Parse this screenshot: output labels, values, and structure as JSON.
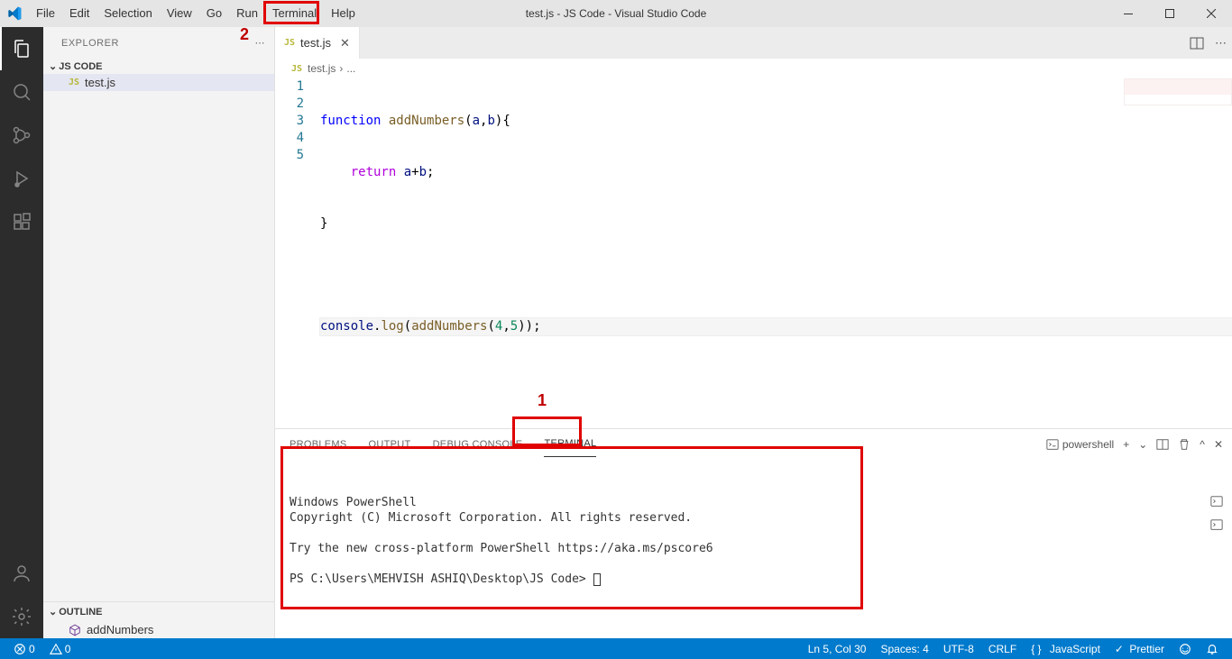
{
  "title": "test.js - JS Code - Visual Studio Code",
  "menu": [
    "File",
    "Edit",
    "Selection",
    "View",
    "Go",
    "Run",
    "Terminal",
    "Help"
  ],
  "sidebar": {
    "title": "EXPLORER",
    "folder": "JS CODE",
    "file": "test.js",
    "outline_title": "OUTLINE",
    "outline_item": "addNumbers"
  },
  "tab": {
    "label": "test.js"
  },
  "breadcrumb": {
    "file": "test.js",
    "sep": "›",
    "rest": "..."
  },
  "code": {
    "lines": [
      "1",
      "2",
      "3",
      "4",
      "5"
    ],
    "l1_kw": "function",
    "l1_fn": " addNumbers",
    "l1_p": "(",
    "l1_a": "a",
    "l1_c": ",",
    "l1_b": "b",
    "l1_rest": "){",
    "l2_indent": "    ",
    "l2_ret": "return",
    "l2_sp": " ",
    "l2_a": "a",
    "l2_op": "+",
    "l2_b": "b",
    "l2_semi": ";",
    "l3": "}",
    "l5_c": "console",
    "l5_dot": ".",
    "l5_log": "log",
    "l5_p1": "(",
    "l5_fn": "addNumbers",
    "l5_p2": "(",
    "l5_n1": "4",
    "l5_cm": ",",
    "l5_n2": "5",
    "l5_end": "));"
  },
  "panel": {
    "tabs": [
      "PROBLEMS",
      "OUTPUT",
      "DEBUG CONSOLE",
      "TERMINAL"
    ],
    "shell": "powershell",
    "body_l1": "",
    "body_l2": "Windows PowerShell",
    "body_l3": "Copyright (C) Microsoft Corporation. All rights reserved.",
    "body_l4": "",
    "body_l5": "Try the new cross-platform PowerShell https://aka.ms/pscore6",
    "body_l6": "",
    "body_l7": "PS C:\\Users\\MEHVISH ASHIQ\\Desktop\\JS Code> "
  },
  "status": {
    "err": "0",
    "warn": "0",
    "lncol": "Ln 5, Col 30",
    "spaces": "Spaces: 4",
    "enc": "UTF-8",
    "eol": "CRLF",
    "lang": "JavaScript",
    "prettier": "Prettier"
  },
  "annot": {
    "one": "1",
    "two": "2"
  }
}
